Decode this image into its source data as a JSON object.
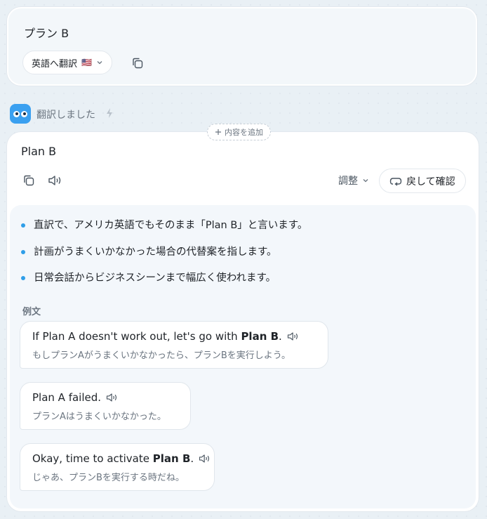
{
  "input": {
    "text": "プラン B",
    "language_select": {
      "label": "英語へ翻訳",
      "flag": "🇺🇸"
    }
  },
  "status": {
    "text": "翻訳しました"
  },
  "add_content": {
    "label": "内容を追加"
  },
  "output": {
    "title": "Plan B",
    "adjust_label": "調整",
    "back_confirm_label": "戻して確認",
    "bullets": [
      "直訳で、アメリカ英語でもそのまま「Plan B」と言います。",
      "計画がうまくいかなかった場合の代替案を指します。",
      "日常会話からビジネスシーンまで幅広く使われます。"
    ],
    "examples_label": "例文",
    "examples": [
      {
        "en_before": "If Plan A doesn't work out, let's go with",
        "en_bold": "Plan B",
        "en_after": ".",
        "ja": "もしプランAがうまくいかなかったら、プランBを実行しよう。"
      },
      {
        "en_before": "Plan A failed.",
        "en_bold": "",
        "en_after": "",
        "ja": "プランAはうまくいかなかった。"
      },
      {
        "en_before": "Okay, time to activate",
        "en_bold": "Plan B",
        "en_after": ".",
        "ja": "じゃあ、プランBを実行する時だね。"
      }
    ]
  },
  "colors": {
    "accent": "#2f9ee8",
    "logo": "#3aa0f0",
    "panel": "#f3f7fb"
  },
  "icons": [
    "copy-icon",
    "speaker-icon",
    "chevron-down-icon",
    "bolt-icon",
    "plus-icon",
    "undo-icon",
    "app-logo-icon"
  ]
}
